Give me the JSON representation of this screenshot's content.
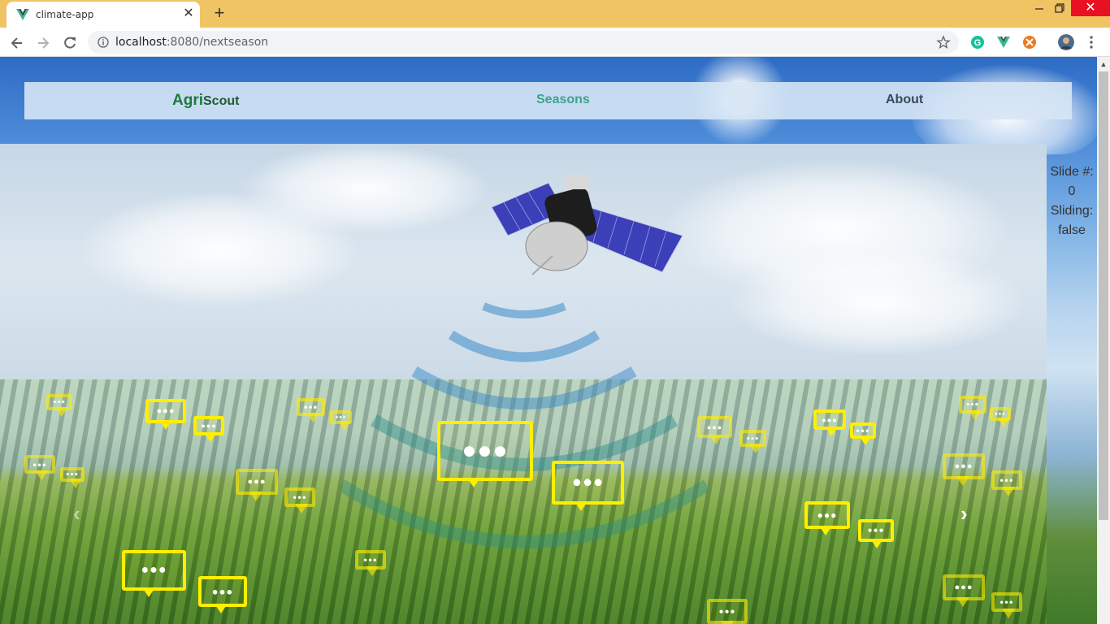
{
  "browser": {
    "tab_title": "climate-app",
    "url_host": "localhost",
    "url_path": ":8080/nextseason"
  },
  "navbar": {
    "brand_primary": "Agri",
    "brand_secondary": "Scout",
    "links": [
      "Seasons",
      "About"
    ]
  },
  "carousel": {
    "prev_icon": "chevron-left-icon",
    "next_icon": "chevron-right-icon"
  },
  "slide_info": {
    "slide_label": "Slide #:",
    "slide_value": "0",
    "sliding_label": "Sliding:",
    "sliding_value": "false"
  },
  "colors": {
    "tabbar": "#f0c463",
    "brand": "#1e7a3c",
    "active_link": "#3aa58a",
    "bubble": "#ffee00"
  }
}
